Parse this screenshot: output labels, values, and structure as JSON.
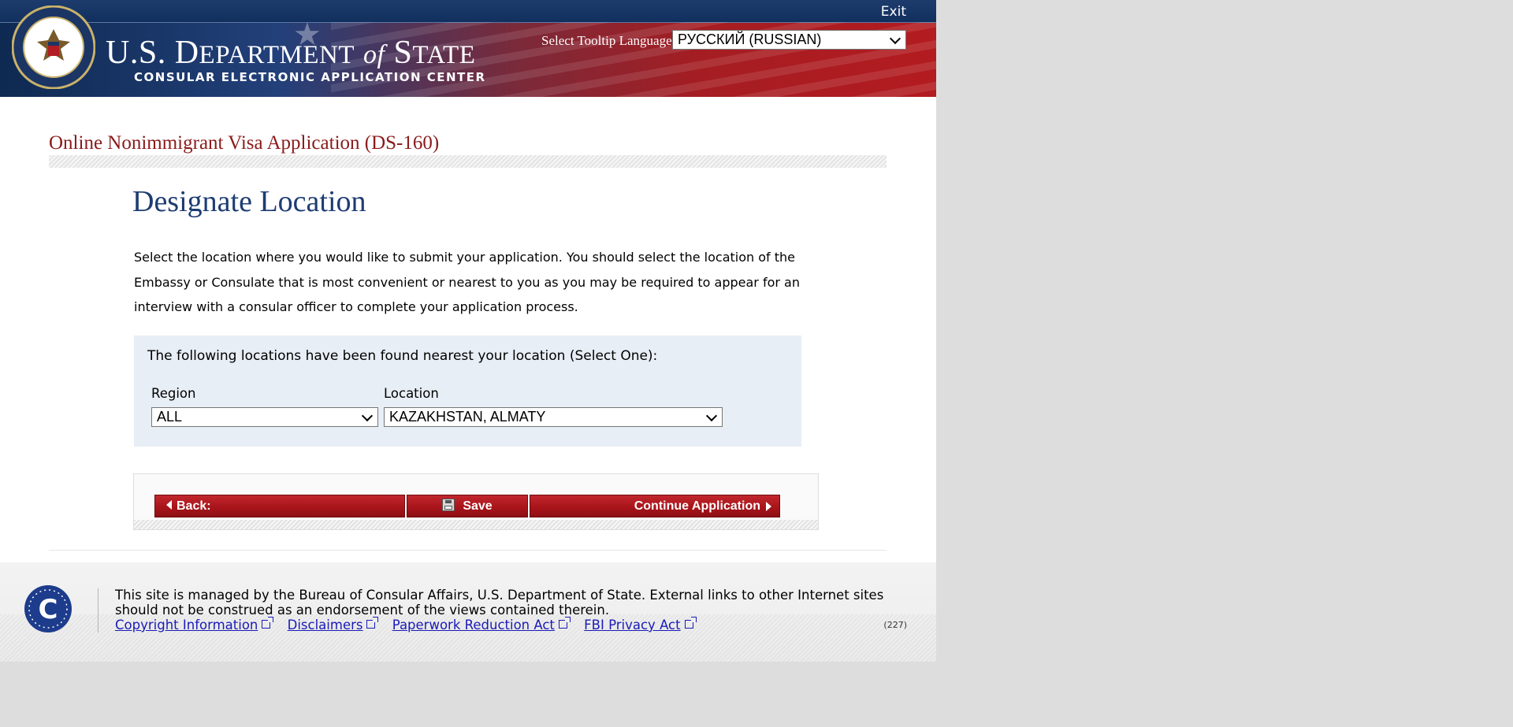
{
  "header": {
    "exit_label": "Exit",
    "dept_title_us": "U.S. D",
    "dept_title_epartment": "EPARTMENT",
    "dept_title_of": "of",
    "dept_title_s": "S",
    "dept_title_tate": "TATE",
    "dept_subtitle": "CONSULAR ELECTRONIC APPLICATION CENTER",
    "tooltip_language_label": "Select Tooltip Language",
    "tooltip_language_value": "РУССКИЙ (RUSSIAN)"
  },
  "main": {
    "app_title": "Online Nonimmigrant Visa Application (DS-160)",
    "page_heading": "Designate Location",
    "intro_text": "Select the location where you would like to submit your application. You should select the location of the Embassy or Consulate that is most convenient or nearest to you as you may be required to appear for an interview with a consular officer to complete your application process.",
    "panel": {
      "prompt": "The following locations have been found nearest your location (Select One):",
      "region_label": "Region",
      "region_value": "ALL",
      "location_label": "Location",
      "location_value": "KAZAKHSTAN, ALMATY"
    },
    "buttons": {
      "back_label": "Back:",
      "save_label": "Save",
      "continue_label": "Continue Application"
    }
  },
  "footer": {
    "notice": "This site is managed by the Bureau of Consular Affairs, U.S. Department of State. External links to other Internet sites should not be construed as an endorsement of the views contained therein.",
    "links": {
      "copyright": "Copyright Information",
      "disclaimers": "Disclaimers",
      "paperwork": "Paperwork Reduction Act",
      "fbi_privacy": "FBI Privacy Act"
    },
    "page_code": "(227)"
  },
  "icons": {
    "seal": "department-of-state-seal",
    "footer_logo": "consular-affairs-logo",
    "back": "triangle-left",
    "save": "floppy-disk",
    "continue": "triangle-right",
    "external_link": "external-link"
  },
  "colors": {
    "accent_red": "#a9151b",
    "heading_blue": "#1d3c72",
    "title_red": "#8b1a1a",
    "panel_bg": "#e8eef5",
    "link_blue": "#1a1ab8"
  }
}
